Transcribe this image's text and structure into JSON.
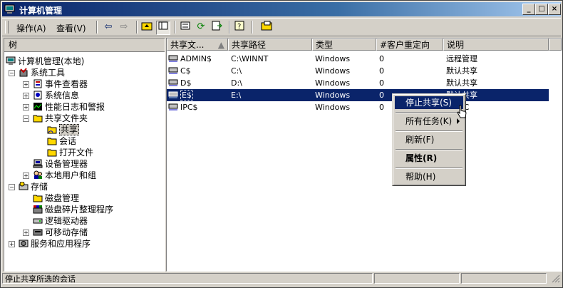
{
  "window": {
    "title": "计算机管理"
  },
  "menu": [
    {
      "label": "操作(A)"
    },
    {
      "label": "查看(V)"
    }
  ],
  "tree": {
    "header": "树",
    "nodes": [
      {
        "label": "计算机管理(本地)",
        "icon": "computer-icon"
      },
      {
        "label": "系统工具",
        "icon": "tools-icon"
      },
      {
        "label": "事件查看器",
        "icon": "event-viewer-icon"
      },
      {
        "label": "系统信息",
        "icon": "system-info-icon"
      },
      {
        "label": "性能日志和警报",
        "icon": "performance-icon"
      },
      {
        "label": "共享文件夹",
        "icon": "folder-icon"
      },
      {
        "label": "共享",
        "icon": "share-folder-icon"
      },
      {
        "label": "会话",
        "icon": "session-folder-icon"
      },
      {
        "label": "打开文件",
        "icon": "open-files-folder-icon"
      },
      {
        "label": "设备管理器",
        "icon": "device-manager-icon"
      },
      {
        "label": "本地用户和组",
        "icon": "users-groups-icon"
      },
      {
        "label": "存储",
        "icon": "storage-icon"
      },
      {
        "label": "磁盘管理",
        "icon": "disk-management-icon"
      },
      {
        "label": "磁盘碎片整理程序",
        "icon": "defrag-icon"
      },
      {
        "label": "逻辑驱动器",
        "icon": "logical-drive-icon"
      },
      {
        "label": "可移动存储",
        "icon": "removable-storage-icon"
      },
      {
        "label": "服务和应用程序",
        "icon": "services-icon"
      }
    ]
  },
  "list": {
    "columns": [
      "共享文...",
      "共享路径",
      "类型",
      "#客户重定向",
      "说明"
    ],
    "rows": [
      {
        "name": "ADMIN$",
        "path": "C:\\WINNT",
        "type": "Windows",
        "clients": "0",
        "desc": "远程管理"
      },
      {
        "name": "C$",
        "path": "C:\\",
        "type": "Windows",
        "clients": "0",
        "desc": "默认共享"
      },
      {
        "name": "D$",
        "path": "D:\\",
        "type": "Windows",
        "clients": "0",
        "desc": "默认共享"
      },
      {
        "name": "E$",
        "path": "E:\\",
        "type": "Windows",
        "clients": "0",
        "desc": "默认共享"
      },
      {
        "name": "IPC$",
        "path": "",
        "type": "Windows",
        "clients": "0",
        "desc": "PC"
      }
    ]
  },
  "context_menu": {
    "items": [
      {
        "label": "停止共享(S)"
      },
      {
        "label": "所有任务(K)"
      },
      {
        "label": "刷新(F)"
      },
      {
        "label": "属性(R)"
      },
      {
        "label": "帮助(H)"
      }
    ]
  },
  "status": {
    "text": "停止共享所选的会话"
  },
  "colors": {
    "title_start": "#0a246a",
    "selection": "#0a246a",
    "face": "#d4d0c8"
  }
}
